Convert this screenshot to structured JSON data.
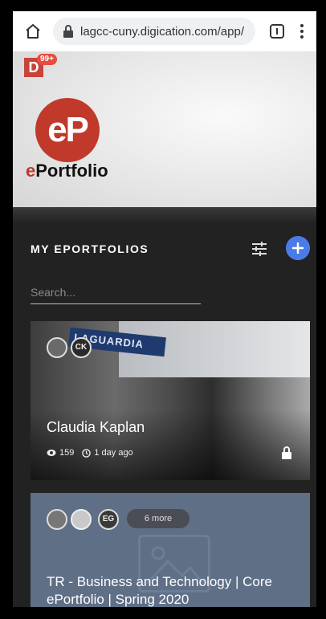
{
  "browser": {
    "url": "lagcc-cuny.digication.com/app/"
  },
  "header": {
    "d_badge": "D",
    "notification_count": "99+",
    "logo_text": "eP",
    "brand_e": "e",
    "brand_rest": "Portfolio"
  },
  "panel": {
    "title": "MY EPORTFOLIOS",
    "search_placeholder": "Search..."
  },
  "cards": [
    {
      "title": "Claudia Kaplan",
      "sign_text": "LAGUARDIA",
      "avatar_initials": "CK",
      "views": "159",
      "time": "1 day ago",
      "locked": true
    },
    {
      "title": "TR - Business and Technology | Core ePortfolio | Spring 2020",
      "avatar_initials": "EG",
      "more": "6 more"
    }
  ],
  "colors": {
    "brand_red": "#c0392b",
    "accent_blue": "#4a7be6",
    "panel_bg": "#222222",
    "card2_bg": "#5f6f86"
  }
}
